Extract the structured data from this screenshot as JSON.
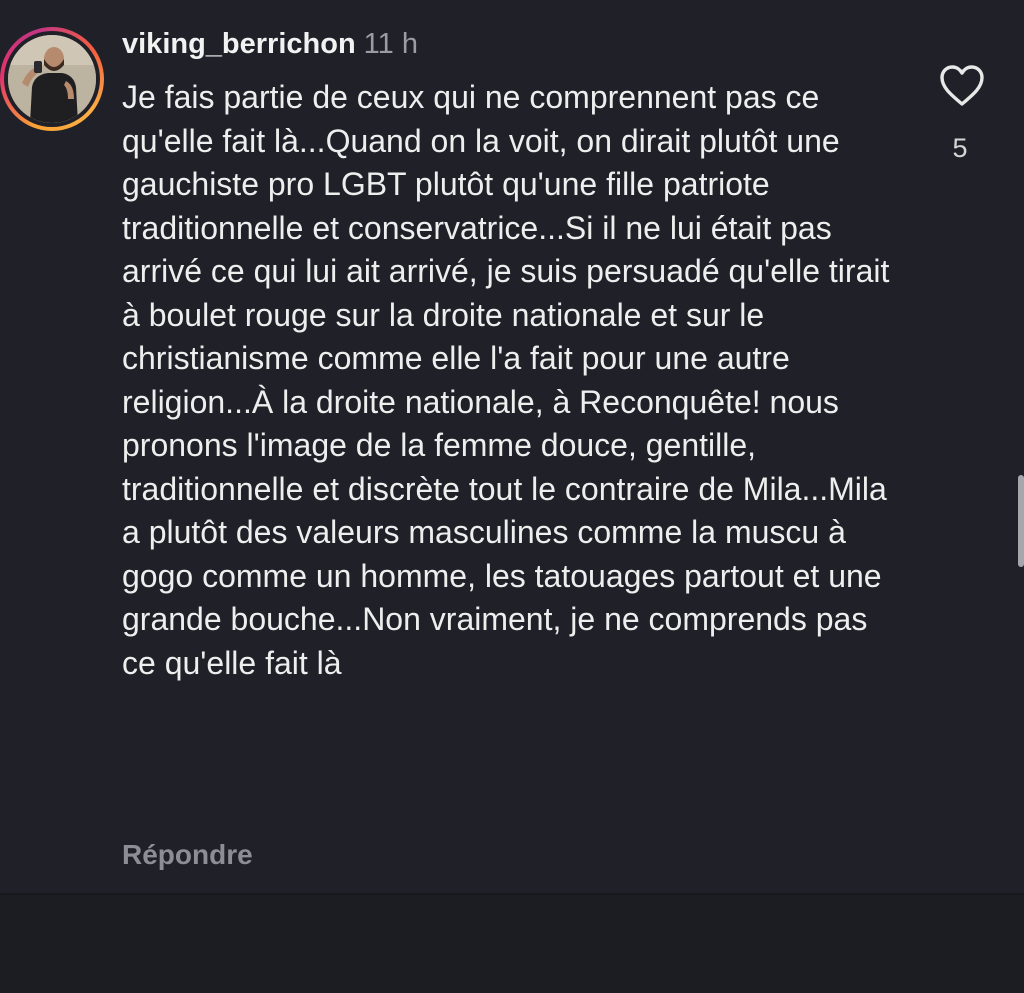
{
  "comment": {
    "username": "viking_berrichon",
    "timestamp": "11 h",
    "text": "Je fais partie de ceux qui ne comprennent pas ce qu'elle fait là...Quand on la voit, on dirait plutôt une gauchiste pro LGBT plutôt qu'une fille patriote traditionnelle et conservatrice...Si il ne lui était pas arrivé ce qui lui ait arrivé, je suis persuadé qu'elle tirait à boulet rouge sur la droite nationale et sur le christianisme comme elle l'a fait pour une autre religion...À la droite nationale, à Reconquête! nous pronons l'image de la femme douce, gentille, traditionnelle et discrète tout le contraire de Mila...Mila a plutôt des valeurs masculines comme la muscu à gogo comme un homme, les tatouages partout et une grande bouche...Non vraiment, je ne comprends pas ce qu'elle fait là",
    "reply_label": "Répondre",
    "like_count": "5",
    "like_icon": "heart-outline-icon"
  },
  "colors": {
    "background": "#202128",
    "text": "#eeeeee",
    "muted": "#9a9ba3",
    "story_ring": [
      "#f9a236",
      "#e2336b",
      "#c13584"
    ]
  }
}
